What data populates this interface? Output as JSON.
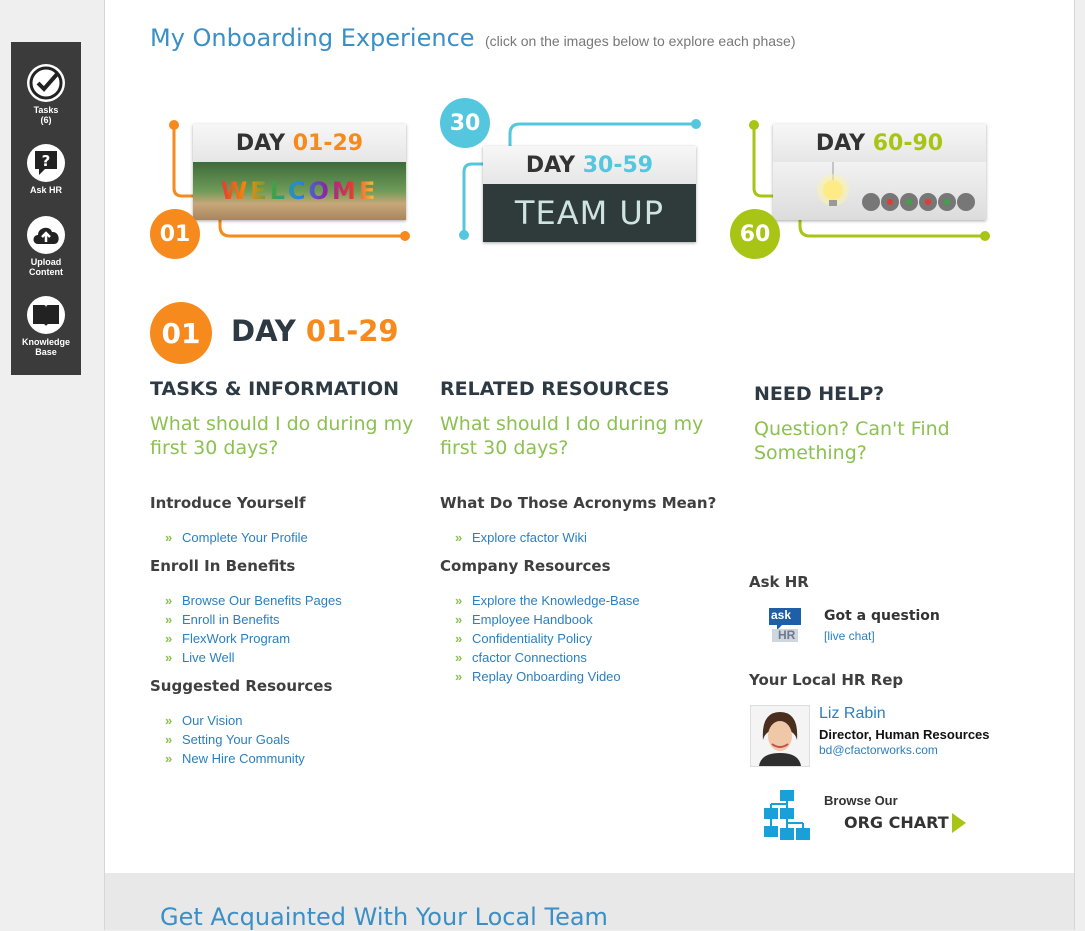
{
  "sidebar": {
    "items": [
      {
        "label": "Tasks",
        "count": "(6)",
        "icon": "tasks-check-icon"
      },
      {
        "label": "Ask HR",
        "icon": "ask-hr-question-icon"
      },
      {
        "label_line1": "Upload",
        "label_line2": "Content",
        "icon": "cloud-upload-icon"
      },
      {
        "label_line1": "Knowledge",
        "label_line2": "Base",
        "icon": "book-icon"
      }
    ]
  },
  "header": {
    "title": "My Onboarding Experience",
    "subtitle": "(click on the images below to explore each phase)"
  },
  "phases": [
    {
      "number": "01",
      "day_label": "DAY",
      "range": "01-29",
      "image_text": "WELCOME",
      "color": "#f78a1d"
    },
    {
      "number": "30",
      "day_label": "DAY",
      "range": "30-59",
      "image_text": "TEAM UP",
      "color": "#54c6dd"
    },
    {
      "number": "60",
      "day_label": "DAY",
      "range": "60-90",
      "image_text": "",
      "color": "#a8c515"
    }
  ],
  "current_phase": {
    "number": "01",
    "day_label": "DAY",
    "range": "01-29"
  },
  "tasks": {
    "heading": "TASKS & INFORMATION",
    "question": "What should I do during my first 30 days?",
    "sections": [
      {
        "title": "Introduce Yourself",
        "links": [
          "Complete Your Profile"
        ]
      },
      {
        "title": "Enroll In Benefits",
        "links": [
          "Browse Our Benefits Pages",
          "Enroll in Benefits",
          "FlexWork Program",
          "Live Well"
        ]
      },
      {
        "title": "Suggested Resources",
        "links": [
          "Our Vision",
          "Setting Your Goals",
          "New Hire Community"
        ]
      }
    ]
  },
  "resources": {
    "heading": "RELATED RESOURCES",
    "question": "What should I do during my first 30 days?",
    "sections": [
      {
        "title": "What Do Those Acronyms Mean?",
        "links": [
          "Explore cfactor Wiki"
        ]
      },
      {
        "title": "Company Resources",
        "links": [
          "Explore the Knowledge-Base",
          "Employee Handbook",
          "Confidentiality Policy",
          "cfactor Connections",
          "Replay Onboarding Video"
        ]
      }
    ]
  },
  "help": {
    "heading": "NEED HELP?",
    "question": "Question?  Can't Find Something?",
    "ask_hr": {
      "title": "Ask HR",
      "logo_line1": "ask",
      "logo_line2": "HR",
      "prompt": "Got a question",
      "link": "[live chat]"
    },
    "local_rep": {
      "title": "Your Local HR Rep",
      "name": "Liz Rabin",
      "role": "Director, Human Resources",
      "email": "bd@cfactorworks.com"
    },
    "org_chart": {
      "line1": "Browse Our",
      "line2": "ORG CHART"
    }
  },
  "bottom": {
    "title": "Get Acquainted With Your Local Team"
  },
  "colors": {
    "orange": "#f78a1d",
    "blue": "#54c6dd",
    "green": "#a8c515",
    "link": "#2b7fc0",
    "question_green": "#8cc152"
  }
}
